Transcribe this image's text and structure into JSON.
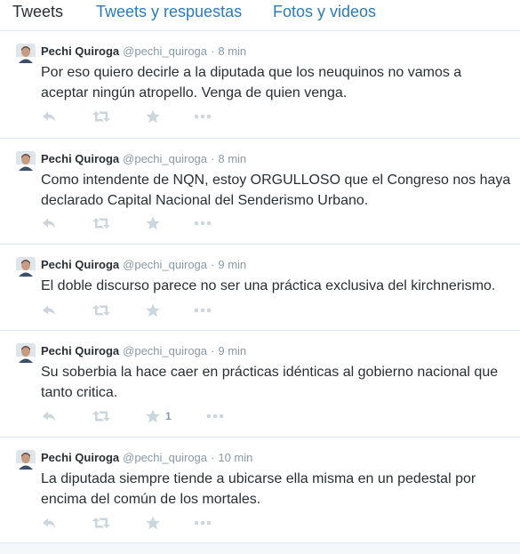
{
  "tabs": [
    {
      "label": "Tweets",
      "active": true
    },
    {
      "label": "Tweets y respuestas",
      "active": false
    },
    {
      "label": "Fotos y videos",
      "active": false
    }
  ],
  "colors": {
    "link": "#2b7bb9",
    "text": "#292f33",
    "muted": "#8899a6",
    "icon": "#ccd6dd",
    "border": "#e1e8ed"
  },
  "tweets": [
    {
      "name": "Pechi Quiroga",
      "handle": "@pechi_quiroga",
      "separator": "·",
      "time": "8 min",
      "text": "Por eso quiero decirle a la diputada que los neuquinos no vamos a aceptar ningún atropello. Venga de quien venga.",
      "fav_count": ""
    },
    {
      "name": "Pechi Quiroga",
      "handle": "@pechi_quiroga",
      "separator": "·",
      "time": "8 min",
      "text": "Como intendente de NQN, estoy ORGULLOSO que el Congreso nos haya declarado Capital Nacional del Senderismo Urbano.",
      "fav_count": ""
    },
    {
      "name": "Pechi Quiroga",
      "handle": "@pechi_quiroga",
      "separator": "·",
      "time": "9 min",
      "text": "El doble discurso parece no ser una práctica exclusiva del kirchnerismo.",
      "fav_count": ""
    },
    {
      "name": "Pechi Quiroga",
      "handle": "@pechi_quiroga",
      "separator": "·",
      "time": "9 min",
      "text": "Su soberbia la hace caer en prácticas idénticas al gobierno nacional que tanto critica.",
      "fav_count": "1"
    },
    {
      "name": "Pechi Quiroga",
      "handle": "@pechi_quiroga",
      "separator": "·",
      "time": "10 min",
      "text": "La diputada siempre tiende a ubicarse ella misma en un pedestal por encima del común de los mortales.",
      "fav_count": ""
    }
  ],
  "icons": {
    "reply": "reply-icon",
    "retweet": "retweet-icon",
    "favorite": "star-icon",
    "more": "more-dots-icon",
    "avatar": "avatar"
  }
}
